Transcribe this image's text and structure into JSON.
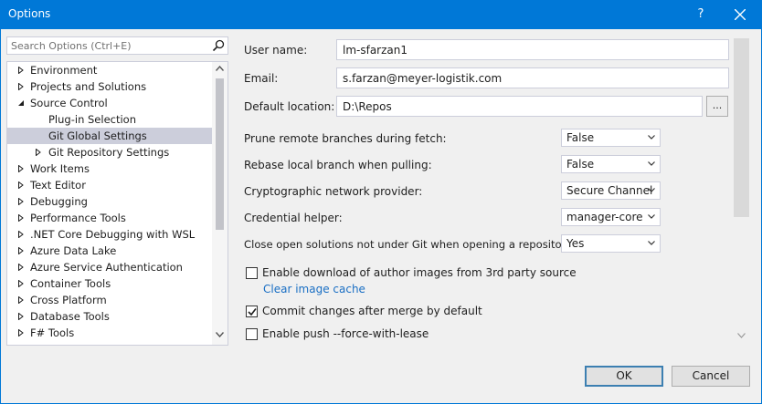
{
  "window": {
    "title": "Options",
    "help_glyph": "?"
  },
  "search": {
    "placeholder": "Search Options (Ctrl+E)"
  },
  "tree": {
    "items": [
      {
        "label": "Environment"
      },
      {
        "label": "Projects and Solutions"
      },
      {
        "label": "Source Control"
      },
      {
        "label": "Plug-in Selection"
      },
      {
        "label": "Git Global Settings"
      },
      {
        "label": "Git Repository Settings"
      },
      {
        "label": "Work Items"
      },
      {
        "label": "Text Editor"
      },
      {
        "label": "Debugging"
      },
      {
        "label": "Performance Tools"
      },
      {
        "label": ".NET Core Debugging with WSL"
      },
      {
        "label": "Azure Data Lake"
      },
      {
        "label": "Azure Service Authentication"
      },
      {
        "label": "Container Tools"
      },
      {
        "label": "Cross Platform"
      },
      {
        "label": "Database Tools"
      },
      {
        "label": "F# Tools"
      }
    ]
  },
  "settings": {
    "user_name_label": "User name:",
    "user_name_value": "lm-sfarzan1",
    "email_label": "Email:",
    "email_value": "s.farzan@meyer-logistik.com",
    "default_location_label": "Default location:",
    "default_location_value": "D:\\Repos",
    "browse_label": "...",
    "prune_label": "Prune remote branches during fetch:",
    "prune_value": "False",
    "rebase_label": "Rebase local branch when pulling:",
    "rebase_value": "False",
    "crypto_label": "Cryptographic network provider:",
    "crypto_value": "Secure Channel",
    "credential_label": "Credential helper:",
    "credential_value": "manager-core",
    "close_solutions_label": "Close open solutions not under Git when opening a repository:",
    "close_solutions_value": "Yes",
    "author_images_label": "Enable download of author images from 3rd party source",
    "author_images_checked": false,
    "clear_cache_link": "Clear image cache",
    "commit_after_merge_label": "Commit changes after merge by default",
    "commit_after_merge_checked": true,
    "force_with_lease_label": "Enable push --force-with-lease",
    "force_with_lease_checked": false
  },
  "buttons": {
    "ok": "OK",
    "cancel": "Cancel"
  }
}
